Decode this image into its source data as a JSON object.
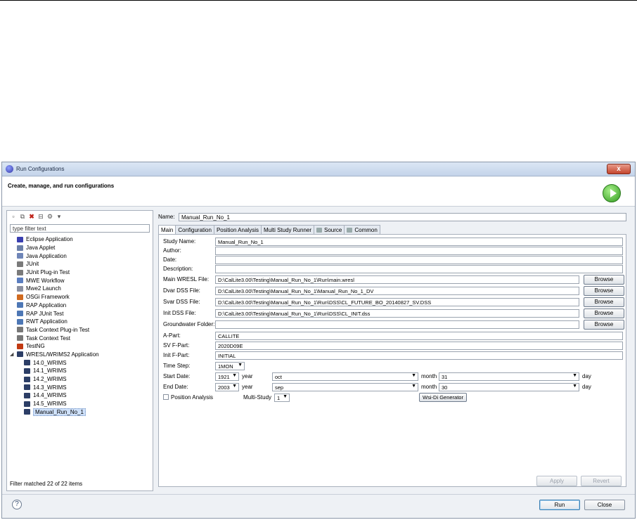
{
  "window": {
    "title": "Run Configurations",
    "close_label": "x",
    "banner_title": "Create, manage, and run configurations"
  },
  "left": {
    "filter_placeholder": "type filter text",
    "items": [
      {
        "label": "Eclipse Application",
        "color": "#3a3fb0",
        "level": 0
      },
      {
        "label": "Java Applet",
        "color": "#6b7fa8",
        "level": 0
      },
      {
        "label": "Java Application",
        "color": "#6f86b8",
        "level": 0
      },
      {
        "label": "JUnit",
        "color": "#7a7a7a",
        "level": 0
      },
      {
        "label": "JUnit Plug-in Test",
        "color": "#7a7a7a",
        "level": 0
      },
      {
        "label": "MWE Workflow",
        "color": "#5b7ec0",
        "level": 0
      },
      {
        "label": "Mwe2 Launch",
        "color": "#8a8fa0",
        "level": 0
      },
      {
        "label": "OSGi Framework",
        "color": "#d06a20",
        "level": 0
      },
      {
        "label": "RAP Application",
        "color": "#4d77b5",
        "level": 0
      },
      {
        "label": "RAP JUnit Test",
        "color": "#4d77b5",
        "level": 0
      },
      {
        "label": "RWT Application",
        "color": "#4d77b5",
        "level": 0
      },
      {
        "label": "Task Context Plug-in Test",
        "color": "#777777",
        "level": 0
      },
      {
        "label": "Task Context Test",
        "color": "#777777",
        "level": 0
      },
      {
        "label": "TestNG",
        "color": "#c23a12",
        "level": 0
      },
      {
        "label": "WRESL/WRIMS2 Application",
        "color": "#2c3e66",
        "level": 0
      },
      {
        "label": "14.0_WRIMS",
        "color": "#2c3e66",
        "level": 1
      },
      {
        "label": "14.1_WRIMS",
        "color": "#2c3e66",
        "level": 1
      },
      {
        "label": "14.2_WRIMS",
        "color": "#2c3e66",
        "level": 1
      },
      {
        "label": "14.3_WRIMS",
        "color": "#2c3e66",
        "level": 1
      },
      {
        "label": "14.4_WRIMS",
        "color": "#2c3e66",
        "level": 1
      },
      {
        "label": "14.5_WRIMS",
        "color": "#2c3e66",
        "level": 1
      },
      {
        "label": "Manual_Run_No_1",
        "color": "#2c3e66",
        "level": 1
      }
    ],
    "filter_status": "Filter matched 22 of 22 items"
  },
  "right": {
    "name_label": "Name:",
    "name_value": "Manual_Run_No_1",
    "tabs": [
      "Main",
      "Configuration",
      "Position Analysis",
      "Multi Study Runner",
      "Source",
      "Common"
    ],
    "fields": {
      "study_name_label": "Study Name:",
      "study_name": "Manual_Run_No_1",
      "author_label": "Author:",
      "author": "",
      "date_label": "Date:",
      "date": "",
      "description_label": "Description:",
      "description": "",
      "main_wresl_label": "Main WRESL File:",
      "main_wresl": "D:\\CalLite3.00\\Testing\\Manual_Run_No_1\\Run\\main.wresl",
      "dvar_label": "Dvar DSS File:",
      "dvar": "D:\\CalLite3.00\\Testing\\Manual_Run_No_1\\Manual_Run_No_1_DV",
      "svar_label": "Svar DSS File:",
      "svar": "D:\\CalLite3.00\\Testing\\Manual_Run_No_1\\Run\\DSS\\CL_FUTURE_BO_20140827_SV.DSS",
      "init_label": "Init DSS File:",
      "init": "D:\\CalLite3.00\\Testing\\Manual_Run_No_1\\Run\\DSS\\CL_INIT.dss",
      "gw_label": "Groundwater Folder:",
      "gw": "",
      "apart_label": "A-Part:",
      "apart": "CALLITE",
      "svf_label": "SV F-Part:",
      "svf": "2020D09E",
      "initf_label": "Init F-Part:",
      "initf": "INITIAL",
      "timestep_label": "Time Step:",
      "timestep": "1MON",
      "start_label": "Start Date:",
      "start_year": "1921",
      "start_month": "oct",
      "start_day": "31",
      "end_label": "End Date:",
      "end_year": "2003",
      "end_month": "sep",
      "end_day": "30",
      "year_unit": "year",
      "month_unit": "month",
      "day_unit": "day",
      "position_analysis_label": "Position Analysis",
      "multistudy_label": "Multi-Study",
      "multistudy_value": "1",
      "wsi_button": "Wsi-Di Generator"
    },
    "browse_label": "Browse",
    "apply_label": "Apply",
    "revert_label": "Revert"
  },
  "footer": {
    "help_label": "?",
    "run_label": "Run",
    "close_label": "Close"
  }
}
